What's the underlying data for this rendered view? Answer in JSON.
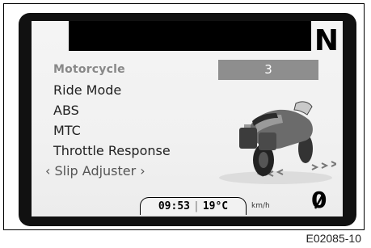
{
  "display": {
    "gear": "N",
    "menu_items": [
      {
        "label": "Motorcycle"
      },
      {
        "label": "Ride Mode"
      },
      {
        "label": "ABS"
      },
      {
        "label": "MTC"
      },
      {
        "label": "Throttle Response"
      },
      {
        "label": "‹ Slip Adjuster ›"
      }
    ],
    "selected_value": "3",
    "status": {
      "time": "09:53",
      "separator": "|",
      "temperature": "19°C"
    },
    "speed": {
      "unit": "km/h",
      "value": "0"
    }
  },
  "figure_code": "E02085-10"
}
